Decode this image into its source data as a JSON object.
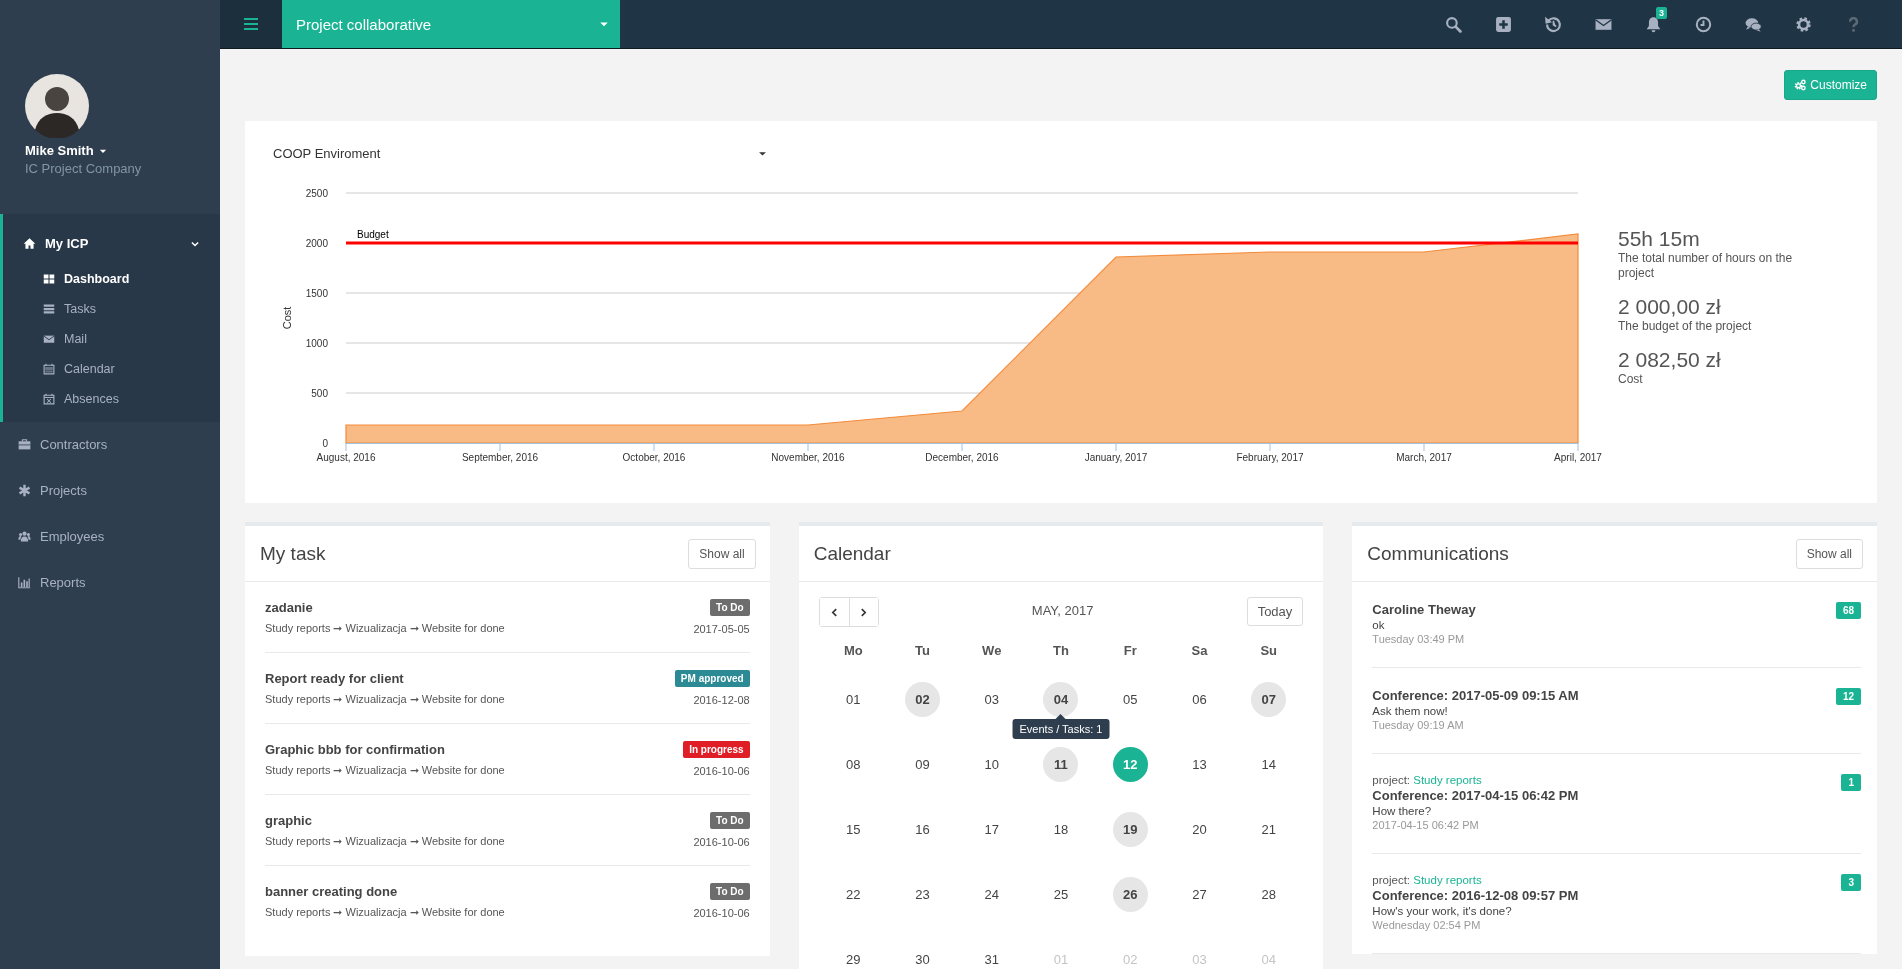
{
  "topbar": {
    "project": "Project collaborative",
    "notification_count": "3"
  },
  "profile": {
    "name": "Mike Smith",
    "company": "IC Project Company"
  },
  "nav": [
    {
      "label": "My ICP",
      "expanded": true,
      "selected": true,
      "children": [
        {
          "label": "Dashboard",
          "selected": true
        },
        {
          "label": "Tasks",
          "selected": false
        },
        {
          "label": "Mail",
          "selected": false
        },
        {
          "label": "Calendar",
          "selected": false
        },
        {
          "label": "Absences",
          "selected": false
        }
      ]
    },
    {
      "label": "Contractors",
      "expanded": false,
      "selected": false
    },
    {
      "label": "Projects",
      "expanded": false,
      "selected": false
    },
    {
      "label": "Employees",
      "expanded": false,
      "selected": false
    },
    {
      "label": "Reports",
      "expanded": false,
      "selected": false
    }
  ],
  "customize_button": "Customize",
  "cost_panel": {
    "environment": "COOP Enviroment",
    "chart_data": {
      "type": "area",
      "ylabel": "Cost",
      "categories": [
        "August, 2016",
        "September, 2016",
        "October, 2016",
        "November, 2016",
        "December, 2016",
        "January, 2017",
        "February, 2017",
        "March, 2017",
        "April, 2017"
      ],
      "series": [
        {
          "color": "#f8bb85",
          "values": [
            180,
            180,
            180,
            180,
            320,
            1860,
            1910,
            1910,
            2090
          ]
        }
      ],
      "ylim": [
        0,
        2500
      ],
      "yticks": [
        0,
        500,
        1000,
        1500,
        2000,
        2500
      ],
      "grid": true,
      "ref_lines": [
        {
          "axis": "y",
          "value": 2000,
          "label": "Budget",
          "color": "#ff0000"
        }
      ]
    },
    "stats": [
      {
        "value": "55h 15m",
        "label": "The total number of hours on the project"
      },
      {
        "value": "2 000,00 zł",
        "label": "The budget of the project"
      },
      {
        "value": "2 082,50 zł",
        "label": "Cost"
      }
    ]
  },
  "tasks": {
    "title": "My task",
    "show_all": "Show all",
    "items": [
      {
        "title": "zadanie",
        "path": "Study reports ➞ Wizualizacja ➞ Website for done",
        "status": "To Do",
        "kind": "todo",
        "date": "2017-05-05"
      },
      {
        "title": "Report ready for client",
        "path": "Study reports ➞ Wizualizacja ➞ Website for done",
        "status": "PM approved",
        "kind": "approved",
        "date": "2016-12-08"
      },
      {
        "title": "Graphic bbb for confirmation",
        "path": "Study reports ➞ Wizualizacja ➞ Website for done",
        "status": "In progress",
        "kind": "progress",
        "date": "2016-10-06"
      },
      {
        "title": "graphic",
        "path": "Study reports ➞ Wizualizacja ➞ Website for done",
        "status": "To Do",
        "kind": "todo",
        "date": "2016-10-06"
      },
      {
        "title": "banner creating done",
        "path": "Study reports ➞ Wizualizacja ➞ Website for done",
        "status": "To Do",
        "kind": "todo",
        "date": "2016-10-06"
      }
    ]
  },
  "calendar": {
    "title": "Calendar",
    "month": "MAY, 2017",
    "today_button": "Today",
    "weekdays": [
      "Mo",
      "Tu",
      "We",
      "Th",
      "Fr",
      "Sa",
      "Su"
    ],
    "days": [
      {
        "label": "01",
        "events": false,
        "today": false,
        "outside": false
      },
      {
        "label": "02",
        "events": true,
        "today": false,
        "outside": false
      },
      {
        "label": "03",
        "events": false,
        "today": false,
        "outside": false
      },
      {
        "label": "04",
        "events": true,
        "today": false,
        "outside": false,
        "tooltip": "Events / Tasks: 1"
      },
      {
        "label": "05",
        "events": false,
        "today": false,
        "outside": false
      },
      {
        "label": "06",
        "events": false,
        "today": false,
        "outside": false
      },
      {
        "label": "07",
        "events": true,
        "today": false,
        "outside": false
      },
      {
        "label": "08",
        "events": false,
        "today": false,
        "outside": false
      },
      {
        "label": "09",
        "events": false,
        "today": false,
        "outside": false
      },
      {
        "label": "10",
        "events": false,
        "today": false,
        "outside": false
      },
      {
        "label": "11",
        "events": true,
        "today": false,
        "outside": false
      },
      {
        "label": "12",
        "events": false,
        "today": true,
        "outside": false
      },
      {
        "label": "13",
        "events": false,
        "today": false,
        "outside": false
      },
      {
        "label": "14",
        "events": false,
        "today": false,
        "outside": false
      },
      {
        "label": "15",
        "events": false,
        "today": false,
        "outside": false
      },
      {
        "label": "16",
        "events": false,
        "today": false,
        "outside": false
      },
      {
        "label": "17",
        "events": false,
        "today": false,
        "outside": false
      },
      {
        "label": "18",
        "events": false,
        "today": false,
        "outside": false
      },
      {
        "label": "19",
        "events": true,
        "today": false,
        "outside": false
      },
      {
        "label": "20",
        "events": false,
        "today": false,
        "outside": false
      },
      {
        "label": "21",
        "events": false,
        "today": false,
        "outside": false
      },
      {
        "label": "22",
        "events": false,
        "today": false,
        "outside": false
      },
      {
        "label": "23",
        "events": false,
        "today": false,
        "outside": false
      },
      {
        "label": "24",
        "events": false,
        "today": false,
        "outside": false
      },
      {
        "label": "25",
        "events": false,
        "today": false,
        "outside": false
      },
      {
        "label": "26",
        "events": true,
        "today": false,
        "outside": false
      },
      {
        "label": "27",
        "events": false,
        "today": false,
        "outside": false
      },
      {
        "label": "28",
        "events": false,
        "today": false,
        "outside": false
      },
      {
        "label": "29",
        "events": false,
        "today": false,
        "outside": false
      },
      {
        "label": "30",
        "events": false,
        "today": false,
        "outside": false
      },
      {
        "label": "31",
        "events": false,
        "today": false,
        "outside": false
      },
      {
        "label": "01",
        "events": false,
        "today": false,
        "outside": true
      },
      {
        "label": "02",
        "events": false,
        "today": false,
        "outside": true
      },
      {
        "label": "03",
        "events": false,
        "today": false,
        "outside": true
      },
      {
        "label": "04",
        "events": false,
        "today": false,
        "outside": true
      }
    ]
  },
  "communications": {
    "title": "Communications",
    "show_all": "Show all",
    "items": [
      {
        "title": "Caroline Theway",
        "message": "ok",
        "time": "Tuesday 03:49 PM",
        "count": "68"
      },
      {
        "title": "Conference: 2017-05-09 09:15 AM",
        "message": "Ask them now!",
        "time": "Tuesday 09:19 AM",
        "count": "12"
      },
      {
        "project_label": "project:",
        "project": "Study reports",
        "title": "Conference: 2017-04-15 06:42 PM",
        "message": "How there?",
        "time": "2017-04-15 06:42 PM",
        "count": "1"
      },
      {
        "project_label": "project:",
        "project": "Study reports",
        "title": "Conference: 2016-12-08 09:57 PM",
        "message": "How's your work, it's done?",
        "time": "Wednesday 02:54 PM",
        "count": "3"
      }
    ]
  }
}
